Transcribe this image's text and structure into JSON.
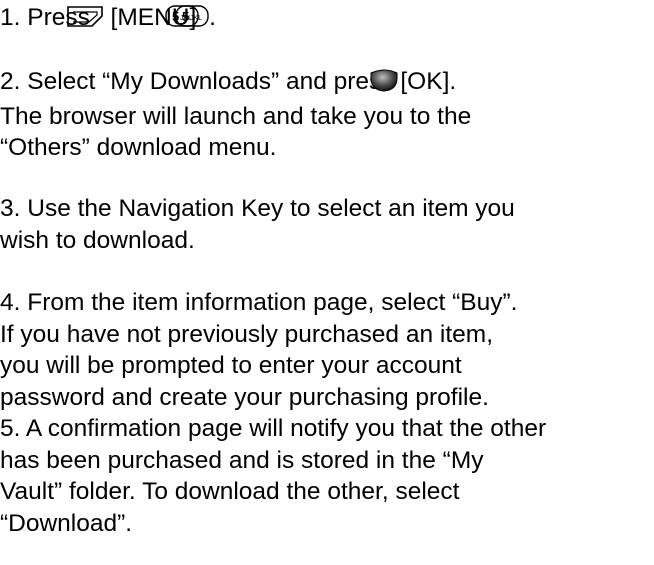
{
  "steps": [
    {
      "number": "1.",
      "lines": [
        "Press",
        "[MENU]",
        "."
      ],
      "icons": [
        "menu-key-icon",
        "5-jkl-key-icon",
        "5-jkl-key-icon"
      ],
      "key_labels": [
        "5",
        "JKL"
      ]
    },
    {
      "number": "2.",
      "lines": [
        "Select “My Downloads” and press",
        "[OK].",
        "The browser will launch and take you to the",
        "“Others” download menu."
      ],
      "icons": [
        "ok-key-icon"
      ]
    },
    {
      "number": "3.",
      "lines": [
        "Use the Navigation Key to select an item you",
        "wish to download."
      ]
    },
    {
      "number": "4.",
      "lines": [
        "From the item information page, select “Buy”.",
        "If you have not previously purchased an item,",
        "you will be prompted to enter your account",
        "password and create your purchasing profile."
      ]
    },
    {
      "number": "5.",
      "lines": [
        "A confirmation page will notify you that the other",
        "has been purchased and is stored in the “My",
        "Vault” folder. To download the other, select",
        "“Download”."
      ]
    }
  ]
}
